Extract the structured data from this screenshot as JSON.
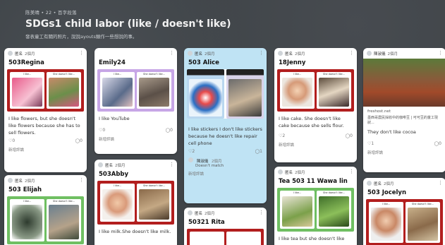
{
  "header": {
    "breadcrumb": "陈美晴 • 22 • 百字段落",
    "title": "SDGs1 child labor (like / doesn't like)",
    "subtitle": "發表童工有關的照片，說說ayouts類作一些想說的事。"
  },
  "cards": {
    "c1": {
      "author": "匿名",
      "time": "2個月",
      "title": "503Regina",
      "pane_left": "I like...",
      "pane_right": "She doesn't like...",
      "desc": "I like flowers, but she doesn't like flowers because she has to sell flowers.",
      "likes": "0",
      "comments": "0",
      "add": "新增評論"
    },
    "c2": {
      "author": "匿名",
      "time": "2個月",
      "title": "503 Elijah",
      "pane_left": "I like...",
      "pane_right": "She doesn't like..."
    },
    "c3": {
      "title": "Emily24",
      "pane_left": "I like...",
      "pane_right": "She doesn't like...",
      "desc": "I like YouTube",
      "likes": "0",
      "comments": "0",
      "add": "新增評論"
    },
    "c4": {
      "author": "匿名",
      "time": "2個月",
      "title": "503Abby",
      "pane_left": "I like...",
      "pane_right": "She doesn't like...",
      "desc": "I like milk.She doesn't like milk."
    },
    "c5": {
      "author": "匿名",
      "time": "2個月",
      "title": "503 Alice",
      "desc": "I like stickers I don't like stickers because he doesn't like repair cell phone",
      "likes": "2",
      "comments": "1",
      "comment_author": "陳淑儀",
      "comment_time": "2個月",
      "comment_text": "Doesn't match",
      "add": "新增評論"
    },
    "c6": {
      "author": "匿名",
      "time": "2個月",
      "title": "50321 Rita"
    },
    "c7": {
      "author": "匿名",
      "time": "2個月",
      "title": "18Jenny",
      "pane_left": "I like...",
      "pane_right": "She doesn't like...",
      "desc": "I like cake. She doesn't like cake because she sells flour.",
      "likes": "2",
      "comments": "0",
      "add": "新增評論"
    },
    "c8": {
      "author": "匿名",
      "time": "2個月",
      "title": "Tea 503 11 Wawa lin",
      "pane_left": "I like...",
      "pane_right": "She doesn't like...",
      "desc": "I like tea but she doesn't like"
    },
    "c9": {
      "author": "陳淑儀",
      "time": "2個月",
      "link": "freshost.net",
      "link_desc": "墨西哥農民採收中的咖啡豆 | 可可豆的童工現狀...",
      "desc": "They don't like cocoa",
      "likes": "1",
      "comments": "0",
      "add": "新增評論"
    },
    "c10": {
      "author": "匿名",
      "time": "2個月",
      "title": "503 Jocelyn",
      "pane_left": "I like...",
      "pane_right": "She doesn't like..."
    }
  },
  "colors": {
    "background": "#3f4448",
    "frame_red": "#b21e1e",
    "frame_purple": "#c7a6e6",
    "frame_green": "#6fbf62",
    "card_blue": "#bfe3f4"
  },
  "icons": {
    "menu": "⋮",
    "heart": "♡",
    "chat": "◯",
    "avatar": "●"
  }
}
